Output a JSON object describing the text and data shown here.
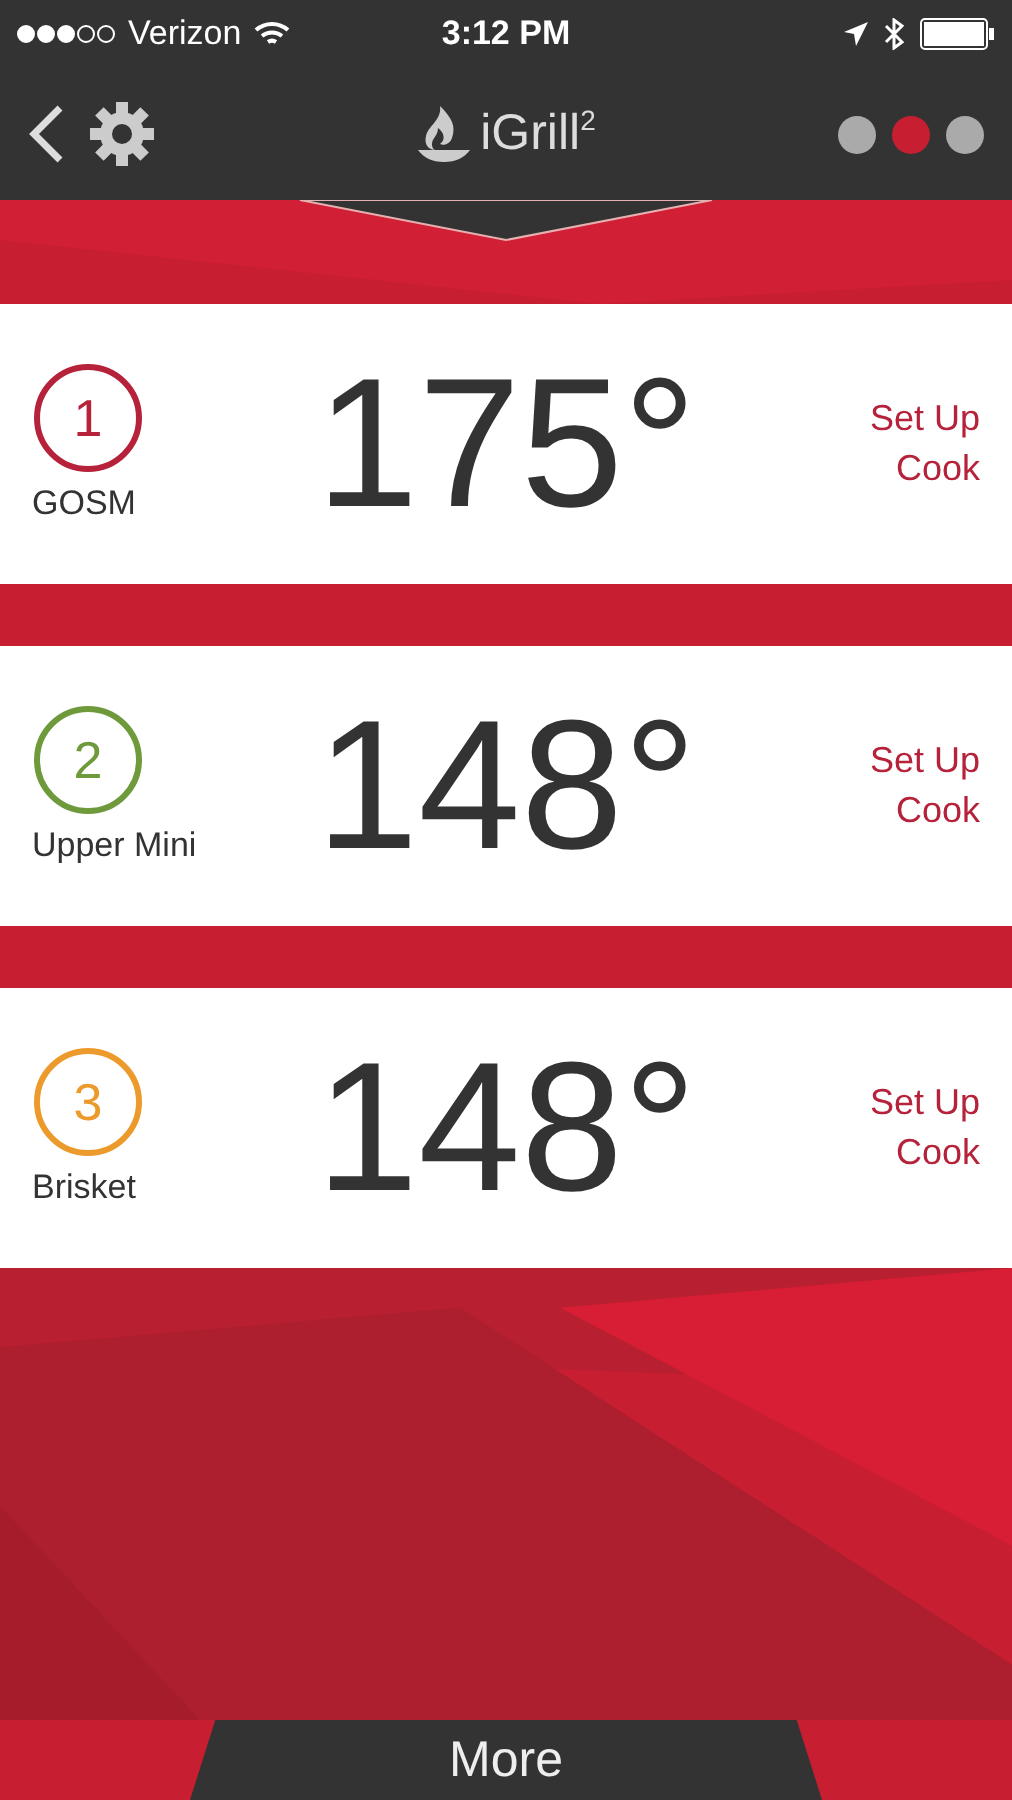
{
  "status_bar": {
    "carrier": "Verizon",
    "time": "3:12 PM"
  },
  "header": {
    "logo": "iGrill$^{2}$",
    "pages": [
      {
        "selected": false
      },
      {
        "selected": true
      },
      {
        "selected": false
      }
    ]
  },
  "probes": [
    {
      "number": "1",
      "name": "GOSM",
      "color": "#b5223a",
      "temperature": "175°",
      "action": "Set Up Cook"
    },
    {
      "number": "2",
      "name": "Upper Mini",
      "color": "#6e9a3c",
      "temperature": "148°",
      "action": "Set Up Cook"
    },
    {
      "number": "3",
      "name": "Brisket",
      "color": "#ec9a2c",
      "temperature": "148°",
      "action": "Set Up Cook"
    }
  ],
  "more_button": "More"
}
